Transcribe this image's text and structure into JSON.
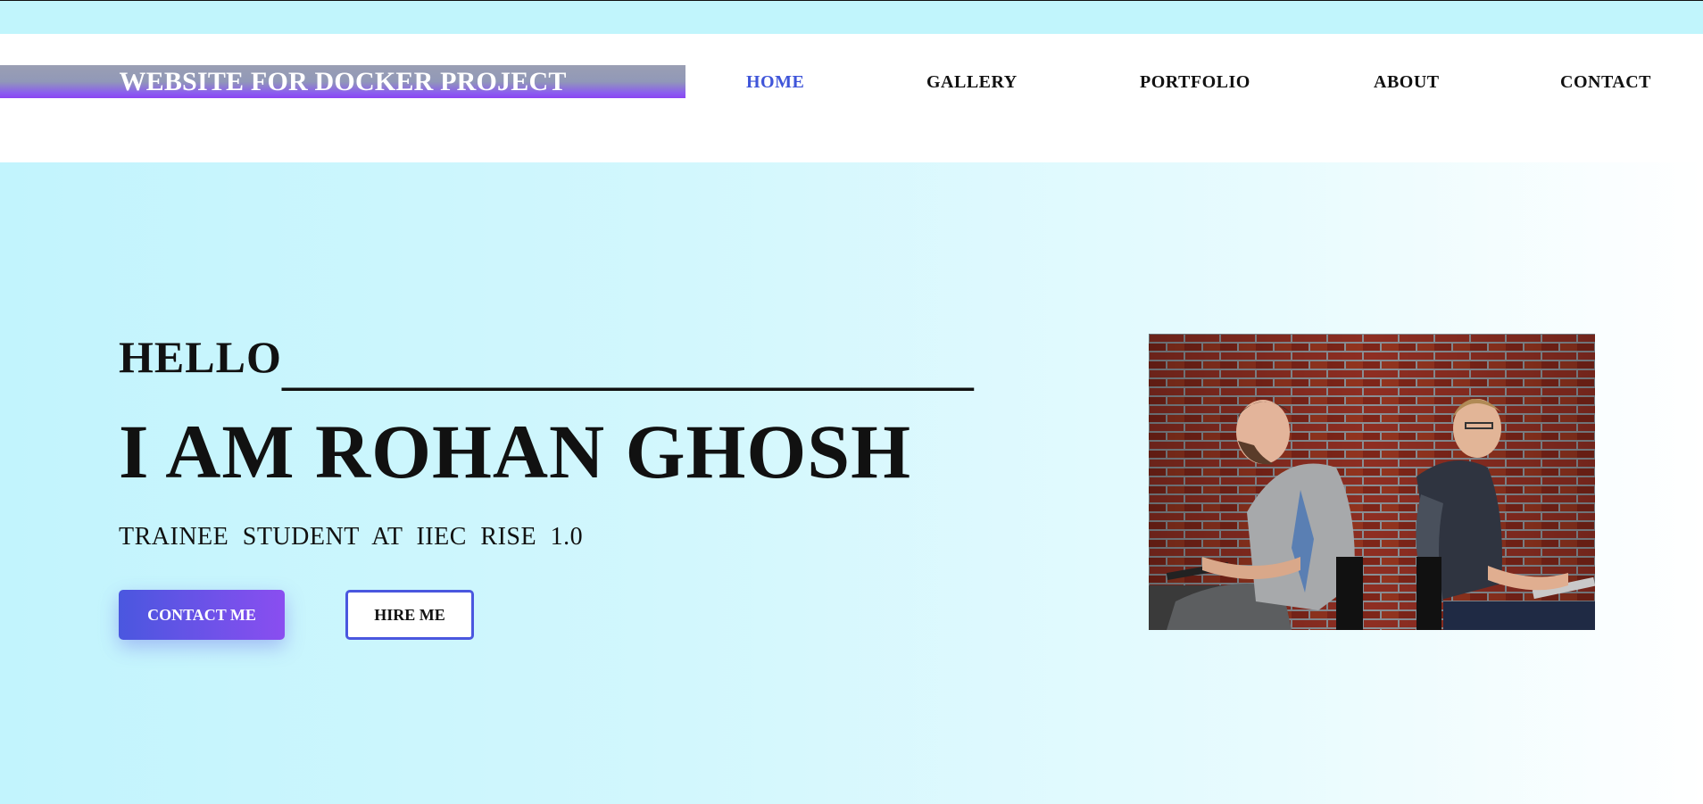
{
  "brand": {
    "title": "WEBSITE FOR DOCKER PROJECT"
  },
  "nav": {
    "items": [
      {
        "label": "HOME",
        "active": true
      },
      {
        "label": "GALLERY",
        "active": false
      },
      {
        "label": "PORTFOLIO",
        "active": false
      },
      {
        "label": "ABOUT",
        "active": false
      },
      {
        "label": "CONTACT",
        "active": false
      }
    ]
  },
  "hero": {
    "greeting": "HELLO",
    "greeting_line": "_______________________________",
    "name": "I AM ROHAN GHOSH",
    "subtitle": "TRAINEE STUDENT AT IIEC RISE 1.0",
    "buttons": {
      "contact": "CONTACT ME",
      "hire": "HIRE ME"
    },
    "image": {
      "subject": "two-men-with-laptops-photo"
    }
  },
  "colors": {
    "accent": "#3f55d9",
    "accent_purple": "#8a4ef0",
    "hero_bg": "#c2f4fd",
    "top_strip": "#c1f5fc"
  }
}
